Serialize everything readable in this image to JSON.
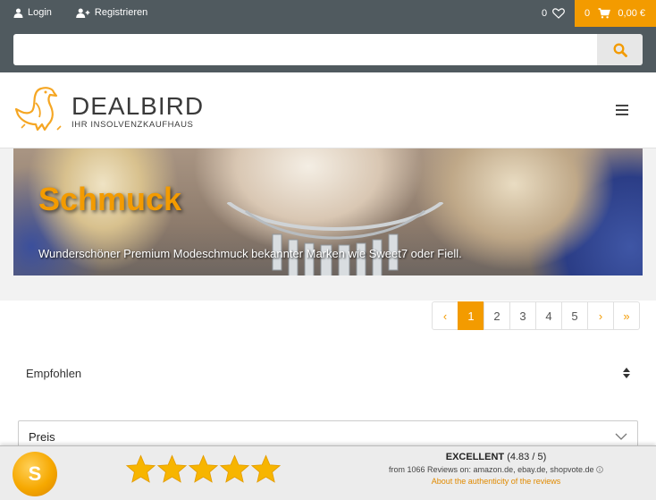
{
  "header": {
    "login_label": "Login",
    "register_label": "Registrieren",
    "wishlist_count": "0",
    "cart_count": "0",
    "cart_total": "0,00 €",
    "search_placeholder": ""
  },
  "brand": {
    "name": "DEALBIRD",
    "tagline": "IHR INSOLVENZKAUFHAUS"
  },
  "hero": {
    "title": "Schmuck",
    "subtitle": "Wunderschöner Premium Modeschmuck bekannter Marken wie Sweet7 oder Fiell."
  },
  "pagination": {
    "prev_label": "‹",
    "pages": [
      "1",
      "2",
      "3",
      "4",
      "5"
    ],
    "current_page": 1,
    "next_label": "›",
    "last_label": "»"
  },
  "filters": {
    "sort_value": "Empfohlen",
    "price_label": "Preis"
  },
  "review_widget": {
    "rating_word": "EXCELLENT",
    "rating_value": "(4.83 / 5)",
    "source_text": "from 1066 Reviews on: amazon.de, ebay.de, shopvote.de",
    "link_text": "About the authenticity of the reviews",
    "stars": 5,
    "seal_letter": "S"
  },
  "colors": {
    "accent": "#f39b00",
    "topbar": "#505a5f",
    "white": "#ffffff"
  },
  "icons": {
    "login": "user-icon",
    "register": "user-plus-icon",
    "wishlist": "heart-icon",
    "cart": "cart-icon",
    "search": "search-icon",
    "menu": "hamburger-menu-icon",
    "sort": "sort-icon",
    "price": "chevron-down-icon",
    "info": "info-icon"
  }
}
